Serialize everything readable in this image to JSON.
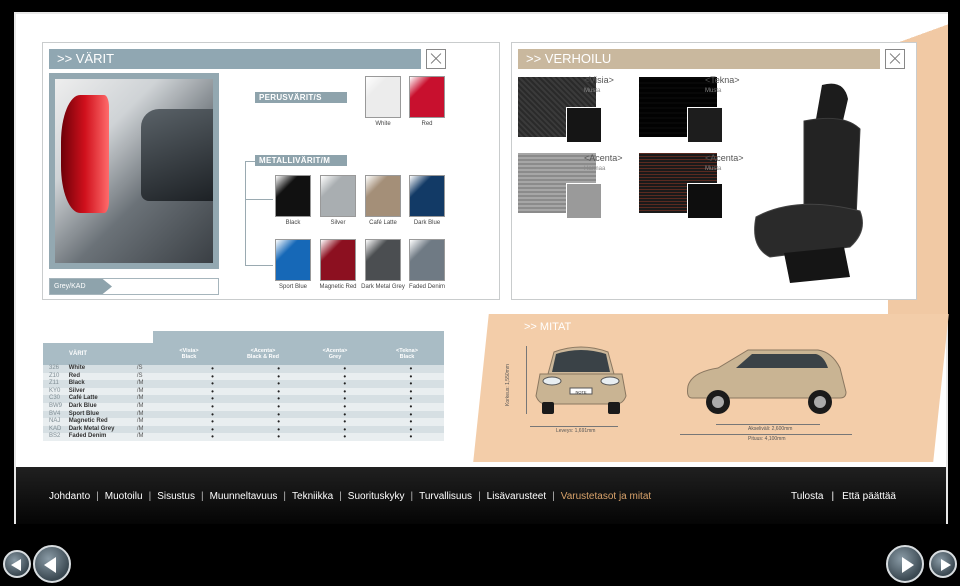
{
  "colors_panel": {
    "title": ">> VÄRIT",
    "group_basic": "PERUSVÄRIT/S",
    "group_metallic": "METALLIVÄRIT/M",
    "basic": [
      {
        "name": "White",
        "color": "#ececec"
      },
      {
        "name": "Red",
        "color": "#c8102e"
      }
    ],
    "metallic_row1": [
      {
        "name": "Black",
        "color": "#111111"
      },
      {
        "name": "Silver",
        "color": "#a9aeb1"
      },
      {
        "name": "Café Latte",
        "color": "#a48f78"
      },
      {
        "name": "Dark Blue",
        "color": "#123a66"
      }
    ],
    "metallic_row2": [
      {
        "name": "Sport Blue",
        "color": "#1668b7"
      },
      {
        "name": "Magnetic Red",
        "color": "#8c1020"
      },
      {
        "name": "Dark Metal Grey",
        "color": "#4b4e51"
      },
      {
        "name": "Faded Denim",
        "color": "#6f7a84"
      }
    ],
    "selected_label": "Grey/KAD"
  },
  "upholstery_panel": {
    "title": ">> VERHOILU",
    "fabrics": [
      {
        "name": "<Visia>",
        "color_name": "Musta"
      },
      {
        "name": "<Tekna>",
        "color_name": "Musta"
      },
      {
        "name": "<Acenta>",
        "color_name": "Harmaa"
      },
      {
        "name": "<Acenta>",
        "color_name": "Musta"
      }
    ]
  },
  "matrix": {
    "head_label": "VÄRIT",
    "columns": [
      {
        "trim": "<Visia>",
        "color": "Black"
      },
      {
        "trim": "<Acenta>",
        "color": "Black & Red"
      },
      {
        "trim": "<Acenta>",
        "color": "Grey"
      },
      {
        "trim": "<Tekna>",
        "color": "Black"
      }
    ],
    "rows": [
      {
        "code": "326",
        "name": "White",
        "type": "/S"
      },
      {
        "code": "Z10",
        "name": "Red",
        "type": "/S"
      },
      {
        "code": "Z11",
        "name": "Black",
        "type": "/M"
      },
      {
        "code": "KY0",
        "name": "Silver",
        "type": "/M"
      },
      {
        "code": "C30",
        "name": "Café Latte",
        "type": "/M"
      },
      {
        "code": "BW9",
        "name": "Dark Blue",
        "type": "/M"
      },
      {
        "code": "BV4",
        "name": "Sport Blue",
        "type": "/M"
      },
      {
        "code": "NAJ",
        "name": "Magnetic Red",
        "type": "/M"
      },
      {
        "code": "KAD",
        "name": "Dark Metal Grey",
        "type": "/M"
      },
      {
        "code": "BS2",
        "name": "Faded Denim",
        "type": "/M"
      }
    ],
    "dot": "•"
  },
  "dimensions": {
    "title": ">> MITAT",
    "height": "Korkeus: 1,550mm",
    "width": "Leveys: 1,691mm",
    "wheelbase": "Akseliväli: 2,600mm",
    "length": "Pituus: 4,100mm",
    "plate": "NOTE"
  },
  "nav": {
    "items": [
      "Johdanto",
      "Muotoilu",
      "Sisustus",
      "Muunneltavuus",
      "Tekniikka",
      "Suorituskyky",
      "Turvallisuus",
      "Lisävarusteet",
      "Varustetasot ja mitat"
    ],
    "active_index": 8,
    "right": [
      "Tulosta",
      "Että päättää"
    ],
    "active_color": "#d9a36b"
  }
}
